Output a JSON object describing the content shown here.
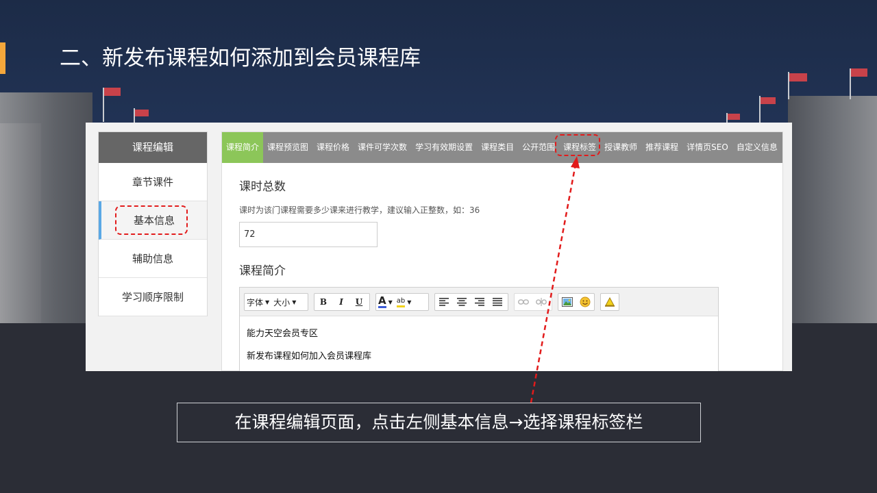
{
  "slide": {
    "title": "二、新发布课程如何添加到会员课程库",
    "caption": "在课程编辑页面，点击左侧基本信息→选择课程标签栏"
  },
  "sidebar": {
    "header": "课程编辑",
    "items": [
      {
        "label": "章节课件"
      },
      {
        "label": "基本信息",
        "active": true
      },
      {
        "label": "辅助信息"
      },
      {
        "label": "学习顺序限制"
      }
    ]
  },
  "tabs": [
    {
      "label": "课程简介",
      "active": true
    },
    {
      "label": "课程预览图"
    },
    {
      "label": "课程价格"
    },
    {
      "label": "课件可学次数"
    },
    {
      "label": "学习有效期设置"
    },
    {
      "label": "课程类目"
    },
    {
      "label": "公开范围"
    },
    {
      "label": "课程标签",
      "highlighted": true
    },
    {
      "label": "授课教师"
    },
    {
      "label": "推荐课程"
    },
    {
      "label": "详情页SEO"
    },
    {
      "label": "自定义信息"
    }
  ],
  "form": {
    "hours_title": "课时总数",
    "hours_hint": "课时为该门课程需要多少课来进行教学，建议输入正整数，如：36",
    "hours_value": "72",
    "intro_title": "课程简介"
  },
  "editor": {
    "font_label": "字体",
    "size_label": "大小",
    "bold": "B",
    "italic": "I",
    "underline": "U",
    "font_color": "A",
    "highlight": "ab",
    "lines": [
      "能力天空会员专区",
      "新发布课程如何加入会员课程库"
    ]
  },
  "colors": {
    "accent": "#f4a73b",
    "tab_active": "#8cc659",
    "annotation": "#e21b1b"
  }
}
